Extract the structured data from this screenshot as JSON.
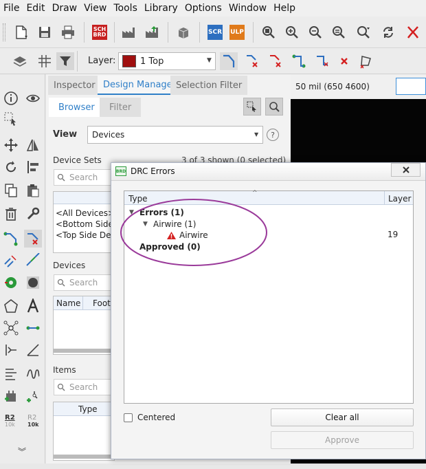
{
  "menu": [
    "File",
    "Edit",
    "Draw",
    "View",
    "Tools",
    "Library",
    "Options",
    "Window",
    "Help"
  ],
  "toolbar": {
    "scr_badge": "SCH BRD",
    "script_label": "SCR",
    "ulp_label": "ULP",
    "layer_label": "Layer:",
    "layer_value": "1 Top",
    "layer_color": "#a01010"
  },
  "left_tools": {
    "r2_a": "R2",
    "r2_a_sub": "10k",
    "r2_b": "R2",
    "r2_b_sub": "10k"
  },
  "panel": {
    "tabs": [
      "Inspector",
      "Design Manager",
      "Selection Filter"
    ],
    "active_tab": "Design Manager",
    "subtabs": [
      "Browser",
      "Filter"
    ],
    "view_label": "View",
    "view_value": "Devices",
    "device_sets_label": "Device Sets",
    "device_sets_count": "3 of 3 shown (0 selected)",
    "search_placeholder": "Search",
    "device_sets_items": [
      "<All Devices>",
      "<Bottom Side",
      "<Top Side Dev"
    ],
    "devices_label": "Devices",
    "devices_columns": [
      "Name",
      "Foot"
    ],
    "items_label": "Items",
    "items_column": "Type"
  },
  "coords": "50 mil (650 4600)",
  "dialog": {
    "title": "DRC Errors",
    "title_icon": "BRD",
    "columns": [
      "Type",
      "Layer"
    ],
    "tree": {
      "errors": "Errors (1)",
      "airwire_group": "Airwire (1)",
      "airwire_item": "Airwire",
      "airwire_layer": "19",
      "approved": "Approved (0)"
    },
    "centered_label": "Centered",
    "clear_all": "Clear all",
    "approve": "Approve"
  },
  "colors": {
    "accent": "#2f7fc8",
    "annotation_circle": "#9a3a9a",
    "canvas": "#050505",
    "warning": "#d42020"
  }
}
